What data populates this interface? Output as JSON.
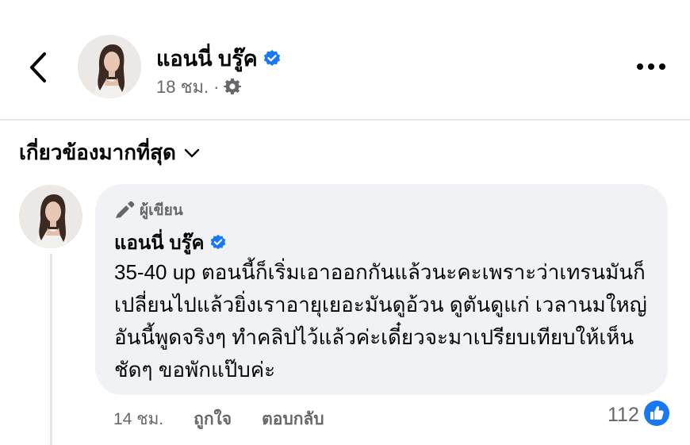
{
  "post": {
    "author": "แอนนี่ บรู๊ค",
    "time": "18 ชม.",
    "separator": "·"
  },
  "sort": {
    "label": "เกี่ยวข้องมากที่สุด"
  },
  "comment": {
    "badge": "ผู้เขียน",
    "author": "แอนนี่ บรู๊ค",
    "text": "35-40 up ตอนนี้ก็เริ่มเอาออกกันแล้วนะคะเพราะว่าเทรนมันก็เปลี่ยนไปแล้วยิ่งเราอายุเยอะมันดูอ้วน ดูตันดูแก่ เวลานมใหญ่ อันนี้พูดจริงๆ ทำคลิปไว้แล้วค่ะเดี๋ยวจะมาเปรียบเทียบให้เห็นชัดๆ ขอพักแป๊บค่ะ",
    "time": "14 ชม.",
    "like_label": "ถูกใจ",
    "reply_label": "ตอบกลับ",
    "reaction_count": "112"
  },
  "icons": {
    "back": "chevron-left-icon",
    "verified": "verified-badge-icon",
    "privacy": "gear-icon",
    "more": "more-dots-icon",
    "sort": "chevron-down-icon",
    "badge": "pen-icon",
    "reaction": "like-icon"
  },
  "colors": {
    "verified": "#1877f2",
    "secondary_text": "#65676b",
    "bubble": "#f0f2f5",
    "divider": "#e4e6eb"
  }
}
